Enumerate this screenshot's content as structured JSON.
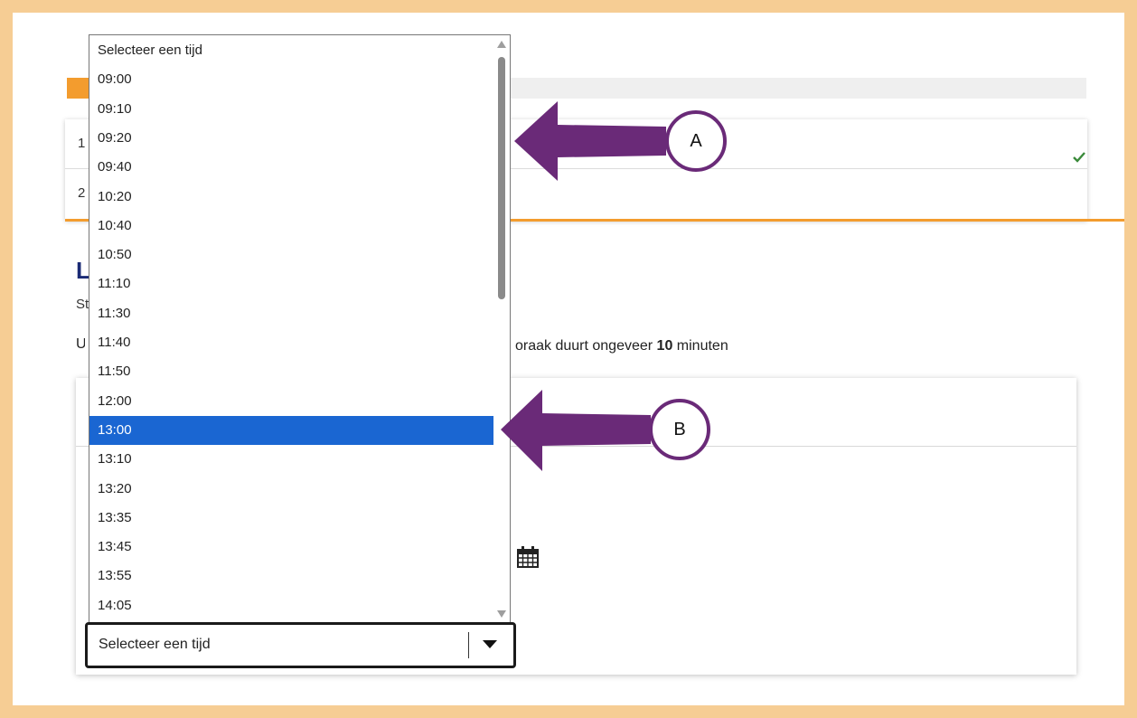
{
  "progress": {
    "percent": 7
  },
  "steps": [
    {
      "number": "1",
      "completed": true
    },
    {
      "number": "2"
    }
  ],
  "page": {
    "heading_fragment": "L",
    "subheading_fragment": "St",
    "info_fragment": "U",
    "duration_prefix": "oraak duurt ongeveer ",
    "duration_value": "10",
    "duration_suffix": " minuten"
  },
  "calendar": {
    "icon": "calendar-icon"
  },
  "time_select": {
    "placeholder": "Selecteer een tijd",
    "options": [
      "Selecteer een tijd",
      "09:00",
      "09:10",
      "09:20",
      "09:40",
      "10:20",
      "10:40",
      "10:50",
      "11:10",
      "11:30",
      "11:40",
      "11:50",
      "12:00",
      "13:00",
      "13:10",
      "13:20",
      "13:35",
      "13:45",
      "13:55",
      "14:05"
    ],
    "selected_option": "13:00",
    "value": "Selecteer een tijd"
  },
  "annotations": [
    {
      "label": "A",
      "color": "#6a2a78"
    },
    {
      "label": "B",
      "color": "#6a2a78"
    }
  ],
  "colors": {
    "border_frame": "#f6cd94",
    "accent_orange": "#f39c2e",
    "heading_blue": "#1b2b75",
    "selection_blue": "#1a66d2",
    "annotation_purple": "#6a2a78",
    "check_green": "#3a8a3a"
  }
}
